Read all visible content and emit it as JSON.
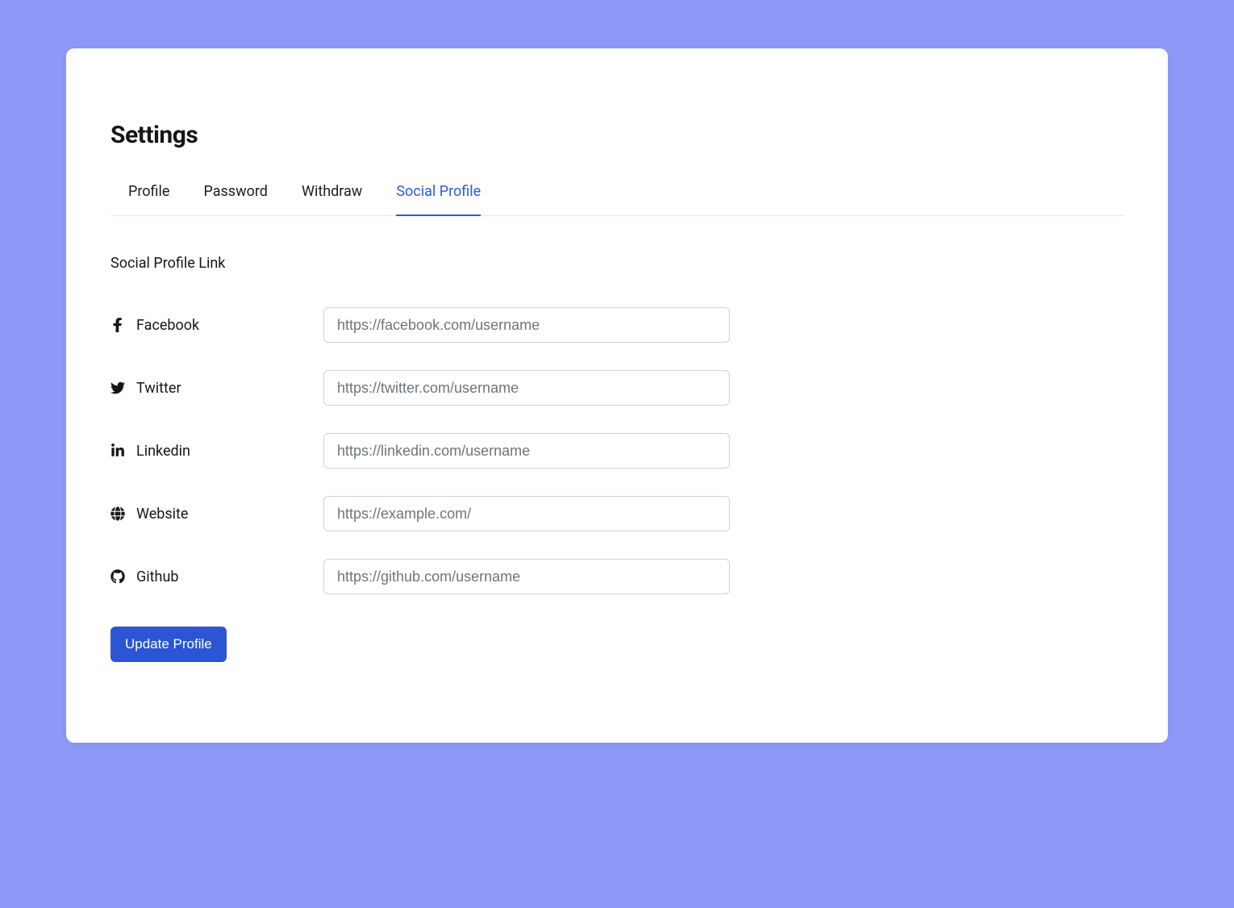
{
  "page_title": "Settings",
  "tabs": [
    {
      "label": "Profile",
      "active": false
    },
    {
      "label": "Password",
      "active": false
    },
    {
      "label": "Withdraw",
      "active": false
    },
    {
      "label": "Social Profile",
      "active": true
    }
  ],
  "section_title": "Social Profile Link",
  "fields": {
    "facebook": {
      "label": "Facebook",
      "placeholder": "https://facebook.com/username",
      "value": ""
    },
    "twitter": {
      "label": "Twitter",
      "placeholder": "https://twitter.com/username",
      "value": ""
    },
    "linkedin": {
      "label": "Linkedin",
      "placeholder": "https://linkedin.com/username",
      "value": ""
    },
    "website": {
      "label": "Website",
      "placeholder": "https://example.com/",
      "value": ""
    },
    "github": {
      "label": "Github",
      "placeholder": "https://github.com/username",
      "value": ""
    }
  },
  "submit_label": "Update Profile"
}
